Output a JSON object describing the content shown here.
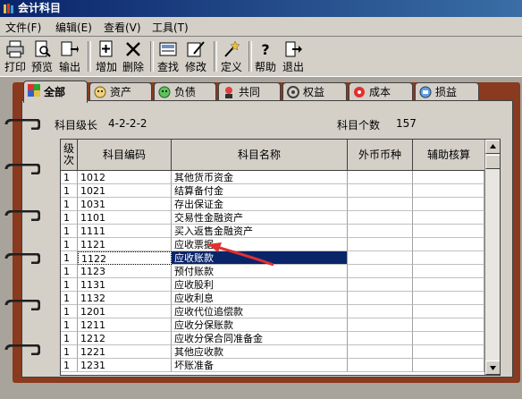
{
  "window": {
    "title": "会计科目"
  },
  "menu": [
    "文件(F)",
    "编辑(E)",
    "查看(V)",
    "工具(T)"
  ],
  "toolbar": [
    {
      "label": "打印",
      "icon": "printer-icon"
    },
    {
      "label": "预览",
      "icon": "preview-icon"
    },
    {
      "label": "输出",
      "icon": "export-icon"
    },
    {
      "label": "增加",
      "icon": "add-icon"
    },
    {
      "label": "删除",
      "icon": "delete-icon"
    },
    {
      "label": "查找",
      "icon": "find-icon"
    },
    {
      "label": "修改",
      "icon": "edit-icon"
    },
    {
      "label": "定义",
      "icon": "define-icon"
    },
    {
      "label": "帮助",
      "icon": "help-icon"
    },
    {
      "label": "退出",
      "icon": "exit-icon"
    }
  ],
  "tabs": [
    {
      "label": "全部",
      "icon": "all-icon",
      "active": true
    },
    {
      "label": "资产",
      "icon": "asset-icon"
    },
    {
      "label": "负债",
      "icon": "liability-icon"
    },
    {
      "label": "共同",
      "icon": "common-icon"
    },
    {
      "label": "权益",
      "icon": "equity-icon"
    },
    {
      "label": "成本",
      "icon": "cost-icon"
    },
    {
      "label": "损益",
      "icon": "profit-loss-icon"
    }
  ],
  "info": {
    "level_label": "科目级长",
    "level_value": "4-2-2-2",
    "count_label": "科目个数",
    "count_value": "157"
  },
  "table": {
    "headers": [
      "级次",
      "科目编码",
      "科目名称",
      "外币币种",
      "辅助核算"
    ],
    "rows": [
      {
        "level": "1",
        "code": "1012",
        "name": "其他货币资金",
        "currency": "",
        "aux": ""
      },
      {
        "level": "1",
        "code": "1021",
        "name": "结算备付金",
        "currency": "",
        "aux": ""
      },
      {
        "level": "1",
        "code": "1031",
        "name": "存出保证金",
        "currency": "",
        "aux": ""
      },
      {
        "level": "1",
        "code": "1101",
        "name": "交易性金融资产",
        "currency": "",
        "aux": ""
      },
      {
        "level": "1",
        "code": "1111",
        "name": "买入返售金融资产",
        "currency": "",
        "aux": ""
      },
      {
        "level": "1",
        "code": "1121",
        "name": "应收票据",
        "currency": "",
        "aux": ""
      },
      {
        "level": "1",
        "code": "1122",
        "name": "应收账款",
        "currency": "",
        "aux": "",
        "selected": true
      },
      {
        "level": "1",
        "code": "1123",
        "name": "预付账款",
        "currency": "",
        "aux": ""
      },
      {
        "level": "1",
        "code": "1131",
        "name": "应收股利",
        "currency": "",
        "aux": ""
      },
      {
        "level": "1",
        "code": "1132",
        "name": "应收利息",
        "currency": "",
        "aux": ""
      },
      {
        "level": "1",
        "code": "1201",
        "name": "应收代位追偿款",
        "currency": "",
        "aux": ""
      },
      {
        "level": "1",
        "code": "1211",
        "name": "应收分保账款",
        "currency": "",
        "aux": ""
      },
      {
        "level": "1",
        "code": "1212",
        "name": "应收分保合同准备金",
        "currency": "",
        "aux": ""
      },
      {
        "level": "1",
        "code": "1221",
        "name": "其他应收款",
        "currency": "",
        "aux": ""
      },
      {
        "level": "1",
        "code": "1231",
        "name": "坏账准备",
        "currency": "",
        "aux": ""
      }
    ]
  },
  "colors": {
    "selection": "#0a246a",
    "book_cover": "#8a3a1e",
    "annotation_arrow": "#e03030"
  }
}
